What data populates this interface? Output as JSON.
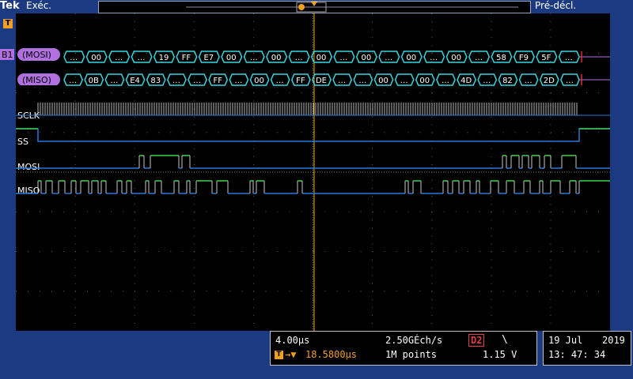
{
  "header": {
    "brand": "Tek",
    "run_state": "Exéc.",
    "trigger_mode": "Pré-décl."
  },
  "trigger_marker": "T",
  "bus": {
    "label": "B1",
    "mosi_label": "(MOSI)",
    "miso_label": "(MISO)",
    "mosi_packets": [
      "…",
      "00",
      "…",
      "…",
      "19",
      "FF",
      "E7",
      "00",
      "…",
      "00",
      "…",
      "00",
      "…",
      "00",
      "…",
      "00",
      "…",
      "00",
      "…",
      "58",
      "F9",
      "5F",
      "…"
    ],
    "miso_packets": [
      "…",
      "0B",
      "…",
      "E4",
      "83",
      "…",
      "…",
      "FF",
      "…",
      "00",
      "…",
      "FF",
      "DE",
      "…",
      "…",
      "00",
      "…",
      "00",
      "…",
      "4D",
      "…",
      "82",
      "…",
      "2D",
      "…"
    ]
  },
  "channels": {
    "sclk": "SCLK",
    "ss": "SS",
    "mosi": "MOSI",
    "miso": "MISO"
  },
  "status": {
    "timebase": "4.00µs",
    "sample_rate": "2.50GÉch/s",
    "trigger_position": "18.5800µs",
    "record_length": "1M points",
    "trigger_source": "D2",
    "trigger_slope": "\\",
    "trigger_level": "1.15 V",
    "date": "19 Jul",
    "year": "2019",
    "time": "13: 47: 34"
  },
  "colors": {
    "background": "#1b3a82",
    "graticule": "#000000",
    "bus": "#3ad6e0",
    "bus_label": "#b070e0",
    "trace_high": "#3cd24a",
    "trace_low": "#2a78d8",
    "trigger": "#f0a020"
  }
}
